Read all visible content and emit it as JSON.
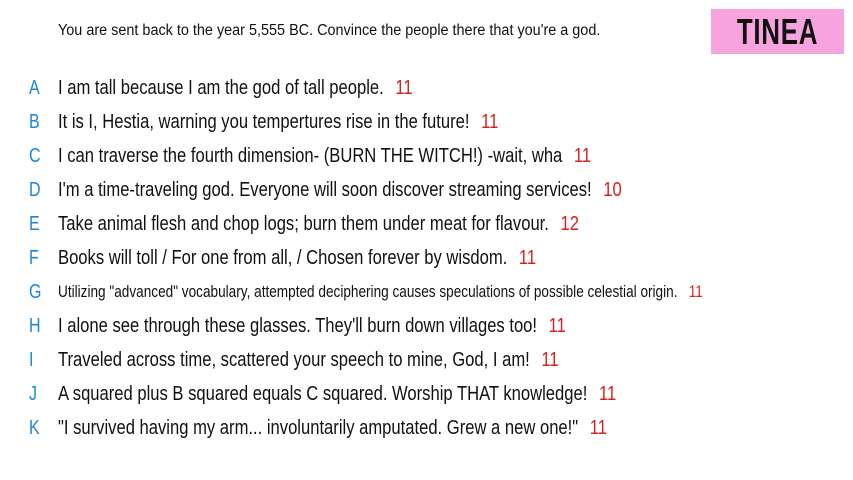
{
  "prompt": "You are sent back to the year 5,555 BC. Convince the people there that you're a god.",
  "badge": "TINEA",
  "colors": {
    "badge_bg": "#f7a3dd",
    "letter": "#1b86d8",
    "score": "#d6221c"
  },
  "answers": [
    {
      "letter": "A",
      "text": "I am tall because I am the god of tall people.",
      "score": "11"
    },
    {
      "letter": "B",
      "text": "It is I, Hestia, warning you tempertures rise in the future!",
      "score": "11"
    },
    {
      "letter": "C",
      "text": "I can traverse the fourth dimension- (BURN THE WITCH!) -wait, wha",
      "score": "11"
    },
    {
      "letter": "D",
      "text": "I'm a time-traveling god. Everyone will soon discover streaming services!",
      "score": "10"
    },
    {
      "letter": "E",
      "text": "Take animal flesh and chop logs; burn them under meat for flavour.",
      "score": "12"
    },
    {
      "letter": "F",
      "text": "Books will toll / For one from all, / Chosen forever by wisdom.",
      "score": "11"
    },
    {
      "letter": "G",
      "text": "Utilizing \"advanced\" vocabulary, attempted deciphering causes speculations of possible celestial origin.",
      "score": "11"
    },
    {
      "letter": "H",
      "text": "I alone see through these glasses. They'll burn down villages too!",
      "score": "11"
    },
    {
      "letter": "I",
      "text": "Traveled across time, scattered your speech to mine, God, I am!",
      "score": "11"
    },
    {
      "letter": "J",
      "text": "A squared plus B squared equals C squared. Worship THAT knowledge!",
      "score": "11"
    },
    {
      "letter": "K",
      "text": "\"I survived having my arm... involuntarily amputated. Grew a new one!\"",
      "score": "11"
    }
  ]
}
